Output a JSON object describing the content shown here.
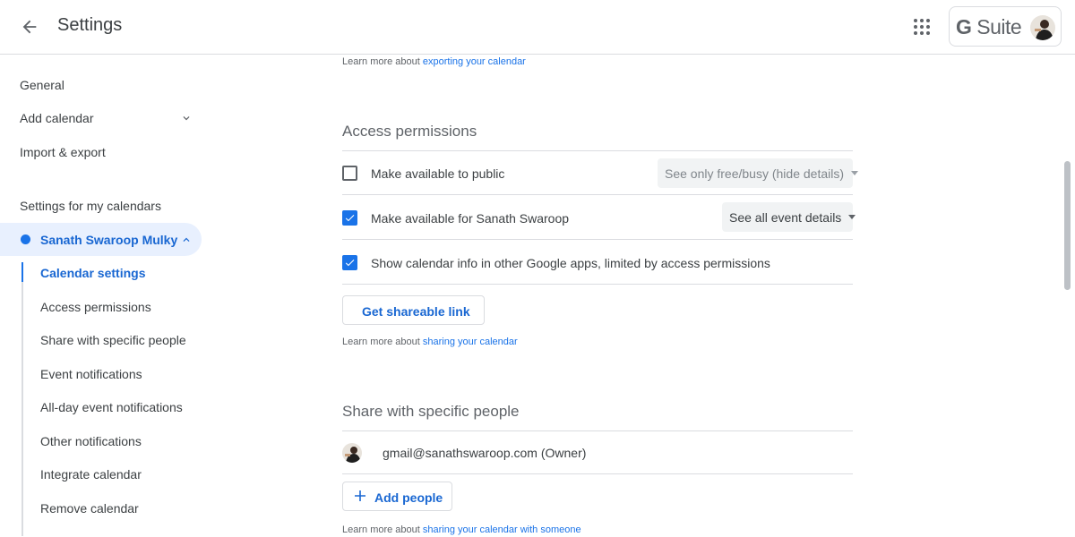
{
  "header": {
    "title": "Settings",
    "suite_label": "Suite"
  },
  "sidebar": {
    "general": "General",
    "add_calendar": "Add calendar",
    "import_export": "Import & export",
    "section_title": "Settings for my calendars",
    "calendar_name": "Sanath Swaroop Mulky",
    "sub_items": [
      "Calendar settings",
      "Access permissions",
      "Share with specific people",
      "Event notifications",
      "All-day event notifications",
      "Other notifications",
      "Integrate calendar",
      "Remove calendar"
    ]
  },
  "main": {
    "export_learn_prefix": "Learn more about ",
    "export_learn_link": "exporting your calendar",
    "access_title": "Access permissions",
    "perm_public_label": "Make available to public",
    "perm_public_checked": false,
    "perm_public_select": "See only free/busy (hide details)",
    "perm_org_label": "Make available for Sanath Swaroop",
    "perm_org_checked": true,
    "perm_org_select": "See all event details",
    "perm_info_label": "Show calendar info in other Google apps, limited by access permissions",
    "perm_info_checked": true,
    "shareable_button": "Get shareable link",
    "sharing_learn_prefix": "Learn more about ",
    "sharing_learn_link": "sharing your calendar",
    "share_title": "Share with specific people",
    "person_entry": "gmail@sanathswaroop.com (Owner)",
    "add_people_button": "Add people",
    "someone_learn_prefix": "Learn more about ",
    "someone_learn_link": "sharing your calendar with someone"
  },
  "icons": {
    "back": "back-arrow-icon",
    "apps": "apps-grid-icon",
    "chevron_down": "chevron-down-icon",
    "chevron_up": "chevron-up-icon",
    "plus": "plus-icon",
    "check": "check-icon"
  },
  "colors": {
    "accent": "#1a73e8",
    "active_text": "#1967d2",
    "active_bg": "#e8f0fe",
    "divider": "#dadce0"
  }
}
